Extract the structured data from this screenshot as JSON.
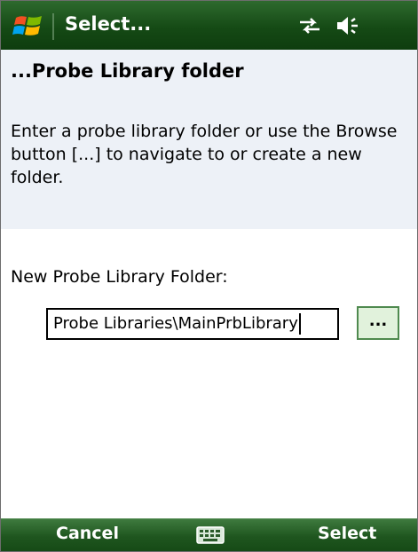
{
  "titlebar": {
    "title": "Select...",
    "start_icon": "windows-flag-icon",
    "connectivity_icon": "connectivity-arrows-icon",
    "volume_icon": "speaker-icon"
  },
  "header": {
    "title": "...Probe Library folder",
    "instructions": "Enter a probe library folder or use the Browse button [...] to navigate to or create a new folder."
  },
  "form": {
    "field_label": "New Probe Library Folder:",
    "path_value": "Probe Libraries\\MainPrbLibrary",
    "browse_label": "..."
  },
  "softkeys": {
    "left_label": "Cancel",
    "right_label": "Select",
    "keyboard_icon": "keyboard-icon"
  },
  "colors": {
    "titlebar": "#154a15",
    "header_panel": "#edf1f7",
    "browse_button": "#e1f2dc"
  }
}
